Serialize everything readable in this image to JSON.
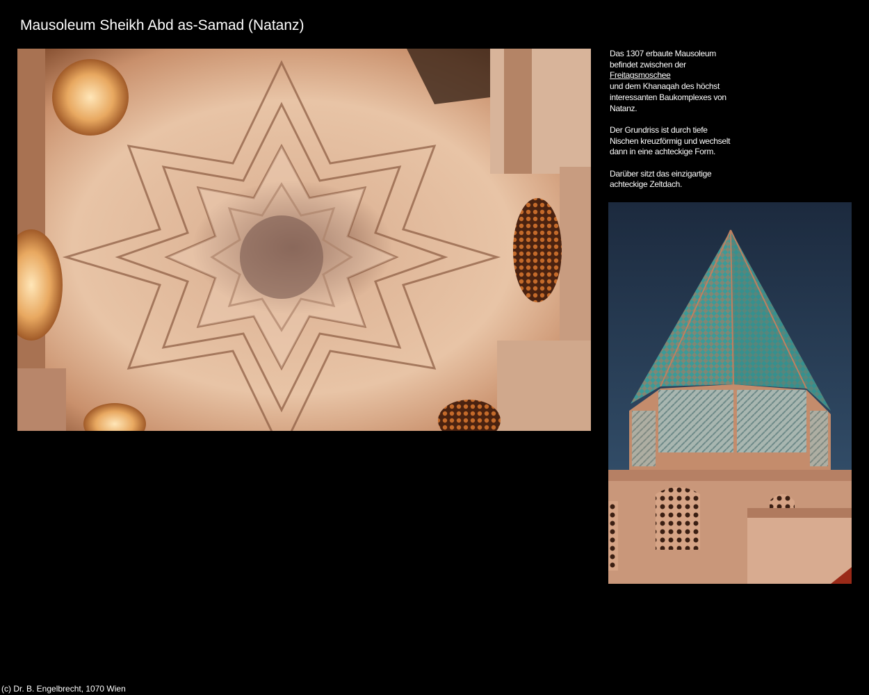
{
  "page": {
    "title": "Mausoleum Sheikh Abd as-Samad (Natanz)"
  },
  "description": {
    "p1_line1": "Das 1307 erbaute Mausoleum",
    "p1_line2": "befindet zwischen der",
    "p1_link": "Freitagsmoschee",
    "p1_line3": "und dem Khanaqah des höchst",
    "p1_line4": "interessanten Baukomplexes von",
    "p1_line5": "Natanz.",
    "p2_line1": "Der Grundriss ist durch tiefe",
    "p2_line2": "Nischen kreuzförmig und wechselt",
    "p2_line3": "dann in eine achteckige Form.",
    "p3_line1": "Darüber sitzt das einzigartige",
    "p3_line2": "achteckige Zeltdach."
  },
  "footer": {
    "copyright": "(c) Dr. B. Engelbrecht, 1070 Wien"
  },
  "colors": {
    "background": "#000000",
    "text": "#ffffff",
    "ceiling_light": "#e8c7ad",
    "ceiling_mid": "#c08a66",
    "ceiling_dark": "#5a2e18",
    "dome_tile": "#3f9c9a",
    "sky": "#24364c",
    "brick": "#c79577"
  }
}
